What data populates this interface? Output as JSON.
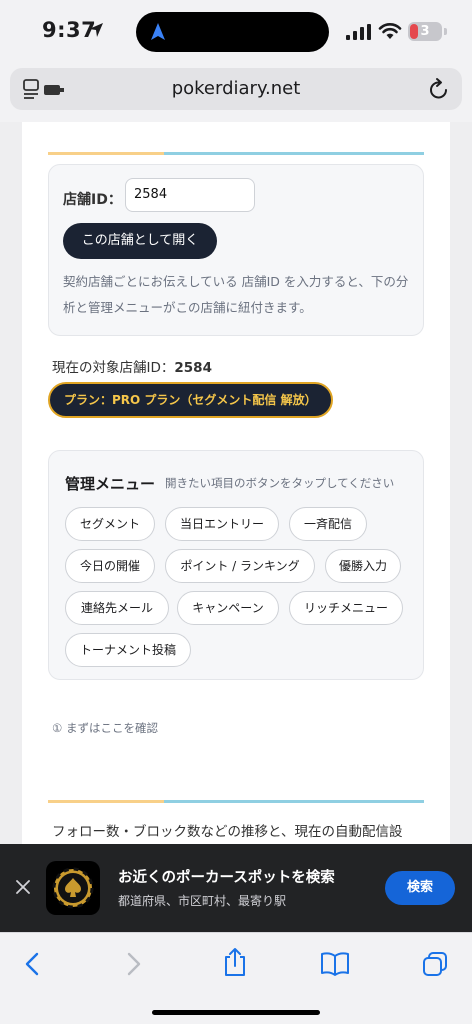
{
  "status": {
    "time": "9:37",
    "battery": "3",
    "colors": {
      "battery_low": "#e5484d"
    }
  },
  "browser": {
    "url": "pokerdiary.net"
  },
  "store_form": {
    "label": "店舗ID：",
    "input_value": "2584",
    "open_button": "この店舗として開く",
    "help_text": "契約店舗ごとにお伝えしている 店舗ID を入力すると、下の分析と管理メニューがこの店舗に紐付きます。"
  },
  "current_store": {
    "label": "現在の対象店舗ID：",
    "value": "2584"
  },
  "plan_badge": "プラン：PRO プラン（セグメント配信 解放）",
  "menu": {
    "title": "管理メニュー",
    "subtitle": "開きたい項目のボタンをタップしてください",
    "items": [
      "セグメント",
      "当日エントリー",
      "一斉配信",
      "今日の開催",
      "ポイント / ランキング",
      "優勝入力",
      "連絡先メール",
      "キャンペーン",
      "リッチメニュー",
      "トーナメント投稿"
    ]
  },
  "confirm_note": "① まずはここを確認",
  "follow_text": "フォロー数・ブロック数などの推移と、現在の自動配信設",
  "banner": {
    "title": "お近くのポーカースポットを検索",
    "subtitle": "都道府県、市区町村、最寄り駅",
    "button": "検索",
    "colors": {
      "button": "#1565d8"
    }
  },
  "toolbar": {
    "icons": [
      "back-icon",
      "forward-icon",
      "share-icon",
      "bookmarks-icon",
      "tabs-icon"
    ]
  },
  "colors": {
    "accent_yellow": "#f8d089",
    "accent_blue": "#8fcfe2",
    "dark_button": "#1b2333",
    "plan_gold": "#f5c64a",
    "link_blue": "#1a73e8"
  }
}
